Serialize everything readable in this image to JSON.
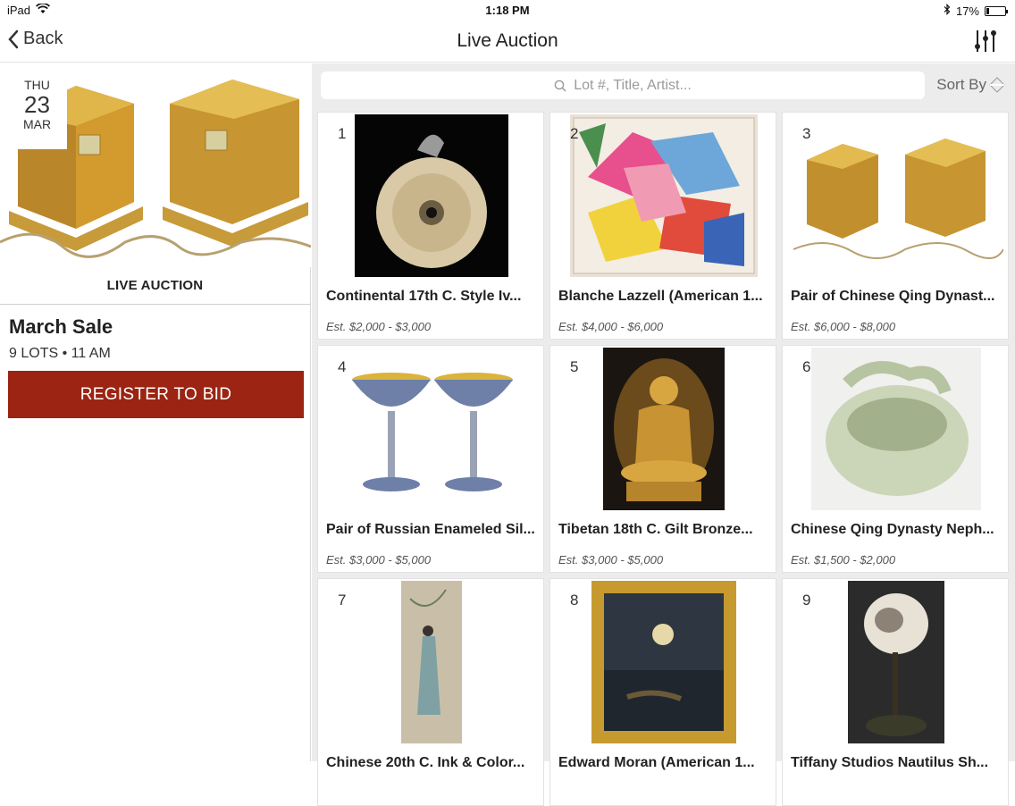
{
  "status": {
    "device": "iPad",
    "time": "1:18 PM",
    "battery": "17%",
    "battery_level": 0.17
  },
  "nav": {
    "back_label": "Back",
    "title": "Live Auction"
  },
  "event": {
    "dow": "THU",
    "day": "23",
    "month": "MAR",
    "section_label": "LIVE AUCTION",
    "sale_title": "March Sale",
    "meta": "9 LOTS • 11 AM",
    "register_label": "REGISTER TO BID"
  },
  "search": {
    "placeholder": "Lot #, Title, Artist..."
  },
  "sort_label": "Sort By",
  "colors": {
    "register": "#9b2412",
    "background": "#ececec"
  },
  "lots": [
    {
      "num": "1",
      "title": "Continental 17th C. Style Iv...",
      "est": "Est. $2,000 - $3,000"
    },
    {
      "num": "2",
      "title": "Blanche Lazzell (American 1...",
      "est": "Est. $4,000 - $6,000"
    },
    {
      "num": "3",
      "title": "Pair of Chinese Qing Dynast...",
      "est": "Est. $6,000 - $8,000"
    },
    {
      "num": "4",
      "title": "Pair of Russian Enameled Sil...",
      "est": "Est. $3,000 - $5,000"
    },
    {
      "num": "5",
      "title": "Tibetan 18th C. Gilt Bronze...",
      "est": "Est. $3,000 - $5,000"
    },
    {
      "num": "6",
      "title": "Chinese Qing Dynasty Neph...",
      "est": "Est. $1,500 - $2,000"
    },
    {
      "num": "7",
      "title": "Chinese 20th C. Ink & Color...",
      "est": ""
    },
    {
      "num": "8",
      "title": "Edward Moran (American 1...",
      "est": ""
    },
    {
      "num": "9",
      "title": "Tiffany Studios Nautilus Sh...",
      "est": ""
    }
  ]
}
